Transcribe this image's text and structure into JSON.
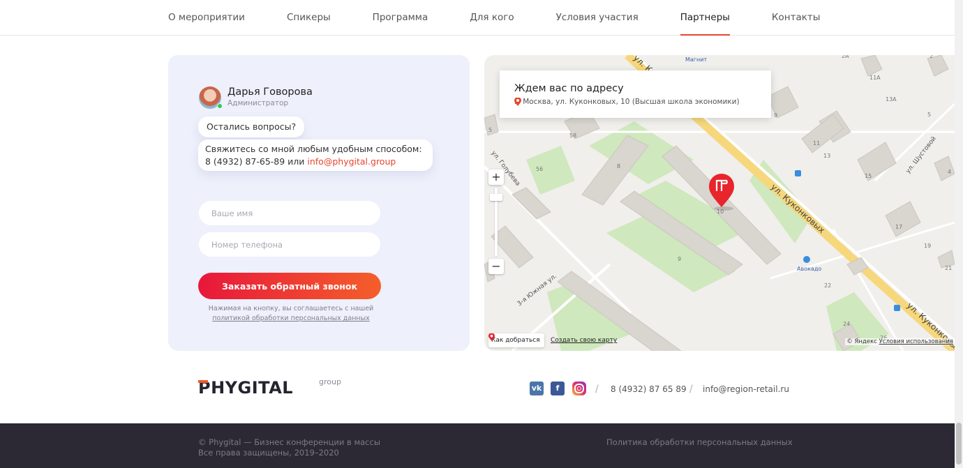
{
  "nav": {
    "items": [
      {
        "label": "О мероприятии"
      },
      {
        "label": "Спикеры"
      },
      {
        "label": "Программа"
      },
      {
        "label": "Для кого"
      },
      {
        "label": "Условия участия"
      },
      {
        "label": "Партнеры",
        "active": true
      },
      {
        "label": "Контакты"
      }
    ],
    "accent_color": "#e8442e"
  },
  "contact": {
    "name": "Дарья Говорова",
    "role": "Администратор",
    "question": "Остались вопросы?",
    "contact_text": "Свяжитесь со мной любым удобным способом:",
    "phone_prefix": "8 (4932) 87-65-89 или ",
    "email": "info@phygital.group",
    "name_placeholder": "Ваше имя",
    "phone_placeholder": "Номер телефона",
    "cta_label": "Заказать обратный звонок",
    "agree_text": "Нажимая на кнопку, вы соглашаетесь с нашей",
    "agree_link": "политикой обработки персональных данных"
  },
  "map": {
    "address_title": "Ждем вас по адресу",
    "address": "г. Москва, ул. Куконковых, 10 (Высшая школа экономики)",
    "zoom_in": "+",
    "zoom_out": "−",
    "route_label": "Как добраться",
    "create_map": "Создать свою карту",
    "copyright": "© Яндекс",
    "terms": "Условия использования",
    "labels": {
      "street_main": "ул. Куконковых",
      "street_main2": "ул. Куконковых",
      "street_top": "ул. Ку",
      "street_golubeva": "ул. Голубева",
      "street_yuzhnaya": "3-я Южная ул.",
      "street_shustovoy": "ул. Шустовой",
      "shop_magnit": "Магнит",
      "shop_avokado": "Авокадо",
      "school_fragment": "кола-\nнат № 3",
      "houses": [
        "2А",
        "11А",
        "13А",
        "5",
        "9",
        "11",
        "13",
        "15",
        "58",
        "8",
        "56",
        "10",
        "17",
        "19",
        "9",
        "22",
        "24",
        "26",
        "21",
        "4",
        "5",
        "2"
      ]
    }
  },
  "footer": {
    "logo_word": "PHYGITAL",
    "logo_group": "group",
    "social": {
      "vk": "vk",
      "fb": "f"
    },
    "phone": "8 (4932) 87 65 89",
    "email": "info@region-retail.ru",
    "copy1": "© Phygital — Бизнес конференции в массы",
    "copy2": "Все права защищены, 2019–2020",
    "policy": "Политика обработки персональных данных"
  }
}
